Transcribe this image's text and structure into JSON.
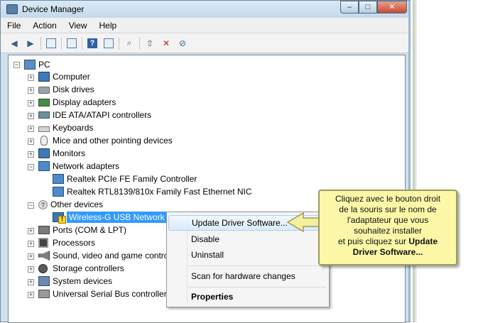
{
  "window": {
    "title": "Device Manager",
    "buttons": {
      "minimize": "–",
      "maximize": "□",
      "close": "✕"
    }
  },
  "menu": [
    "File",
    "Action",
    "View",
    "Help"
  ],
  "toolbar": {
    "icons": [
      "back-icon",
      "forward-icon",
      "show-hide-tree-icon",
      "properties-icon",
      "help-icon",
      "view-icon",
      "scan-hardware-icon",
      "update-driver-icon",
      "uninstall-icon",
      "disable-icon"
    ]
  },
  "tree": {
    "root": "PC",
    "categories": [
      {
        "label": "Computer",
        "icon": "computer-icon"
      },
      {
        "label": "Disk drives",
        "icon": "disk-icon"
      },
      {
        "label": "Display adapters",
        "icon": "display-icon"
      },
      {
        "label": "IDE ATA/ATAPI controllers",
        "icon": "ide-icon"
      },
      {
        "label": "Keyboards",
        "icon": "keyboard-icon"
      },
      {
        "label": "Mice and other pointing devices",
        "icon": "mouse-icon"
      },
      {
        "label": "Monitors",
        "icon": "monitor-icon"
      },
      {
        "label": "Network adapters",
        "icon": "network-icon"
      },
      {
        "label": "Realtek PCIe FE Family Controller",
        "icon": "network-icon"
      },
      {
        "label": "Realtek RTL8139/810x Family Fast Ethernet NIC",
        "icon": "network-icon"
      },
      {
        "label": "Other devices",
        "icon": "other-devices-icon"
      },
      {
        "label": "Wireless-G USB Network Adapter",
        "icon": "warning-device-icon"
      },
      {
        "label": "Ports (COM & LPT)",
        "icon": "port-icon"
      },
      {
        "label": "Processors",
        "icon": "processor-icon"
      },
      {
        "label": "Sound, video and game controllers",
        "icon": "sound-icon"
      },
      {
        "label": "Storage controllers",
        "icon": "storage-icon"
      },
      {
        "label": "System devices",
        "icon": "system-icon"
      },
      {
        "label": "Universal Serial Bus controllers",
        "icon": "usb-icon"
      }
    ]
  },
  "context_menu": {
    "items": [
      "Update Driver Software...",
      "Disable",
      "Uninstall",
      "Scan for hardware changes",
      "Properties"
    ]
  },
  "callout": {
    "line1": "Cliquez  avec le bouton droit",
    "line2": "de la souris sur le nom de",
    "line3": "l'adaptateur que vous",
    "line4": "souhaitez installer",
    "line5_pre": "et puis cliquez sur ",
    "line5_bold": "Update",
    "line6_bold": "Driver Software..."
  },
  "colors": {
    "selection": "#3399ff",
    "callout_bg": "#fcf8a8",
    "arrow": "#f4ef9d"
  }
}
